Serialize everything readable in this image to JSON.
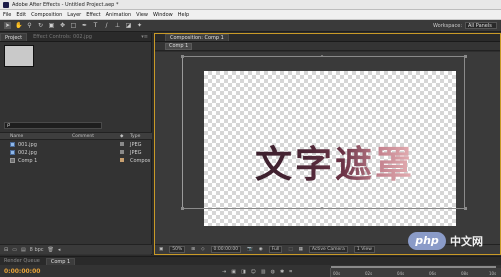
{
  "window": {
    "title": "Adobe After Effects - Untitled Project.aep *"
  },
  "menu": [
    "File",
    "Edit",
    "Composition",
    "Layer",
    "Effect",
    "Animation",
    "View",
    "Window",
    "Help"
  ],
  "toolbar": {
    "tools": [
      "selection-tool",
      "hand-tool",
      "zoom-tool",
      "rotate-tool",
      "camera-tool",
      "pan-behind-tool",
      "rectangle-tool",
      "pen-tool",
      "text-tool",
      "brush-tool",
      "clone-tool",
      "eraser-tool",
      "puppet-tool"
    ],
    "workspace_label": "Workspace:",
    "workspace_value": "All Panels"
  },
  "project_panel": {
    "tab_project": "Project",
    "tab_effect_controls": "Effect Controls: 002.jpg",
    "search_placeholder": "ρ",
    "columns": {
      "name": "Name",
      "comment": "Comment",
      "type": "Type"
    },
    "items": [
      {
        "name": "001.jpg",
        "type": "JPEG",
        "kind": "file",
        "label_color": "#8a8a8a"
      },
      {
        "name": "002.jpg",
        "type": "JPEG",
        "kind": "file",
        "label_color": "#8a8a8a"
      },
      {
        "name": "Comp 1",
        "type": "Compos",
        "kind": "comp",
        "label_color": "#c8a070"
      }
    ],
    "bpc": "8 bpc"
  },
  "composition_panel": {
    "tab_label": "Composition: Comp 1",
    "flow_button": "Comp 1",
    "text": "文字遮罩",
    "footer": {
      "zoom": "50%",
      "timecode": "0:00:00:00",
      "resolution": "Full",
      "camera": "Active Camera",
      "views": "1 View"
    }
  },
  "timeline": {
    "tab_render_queue": "Render Queue",
    "tab_comp": "Comp 1",
    "timecode": "0:00:00:00",
    "ticks": [
      "00s",
      "02s",
      "04s",
      "06s",
      "08s",
      "10s"
    ]
  },
  "watermark": {
    "logo": "php",
    "text": "中文网"
  }
}
